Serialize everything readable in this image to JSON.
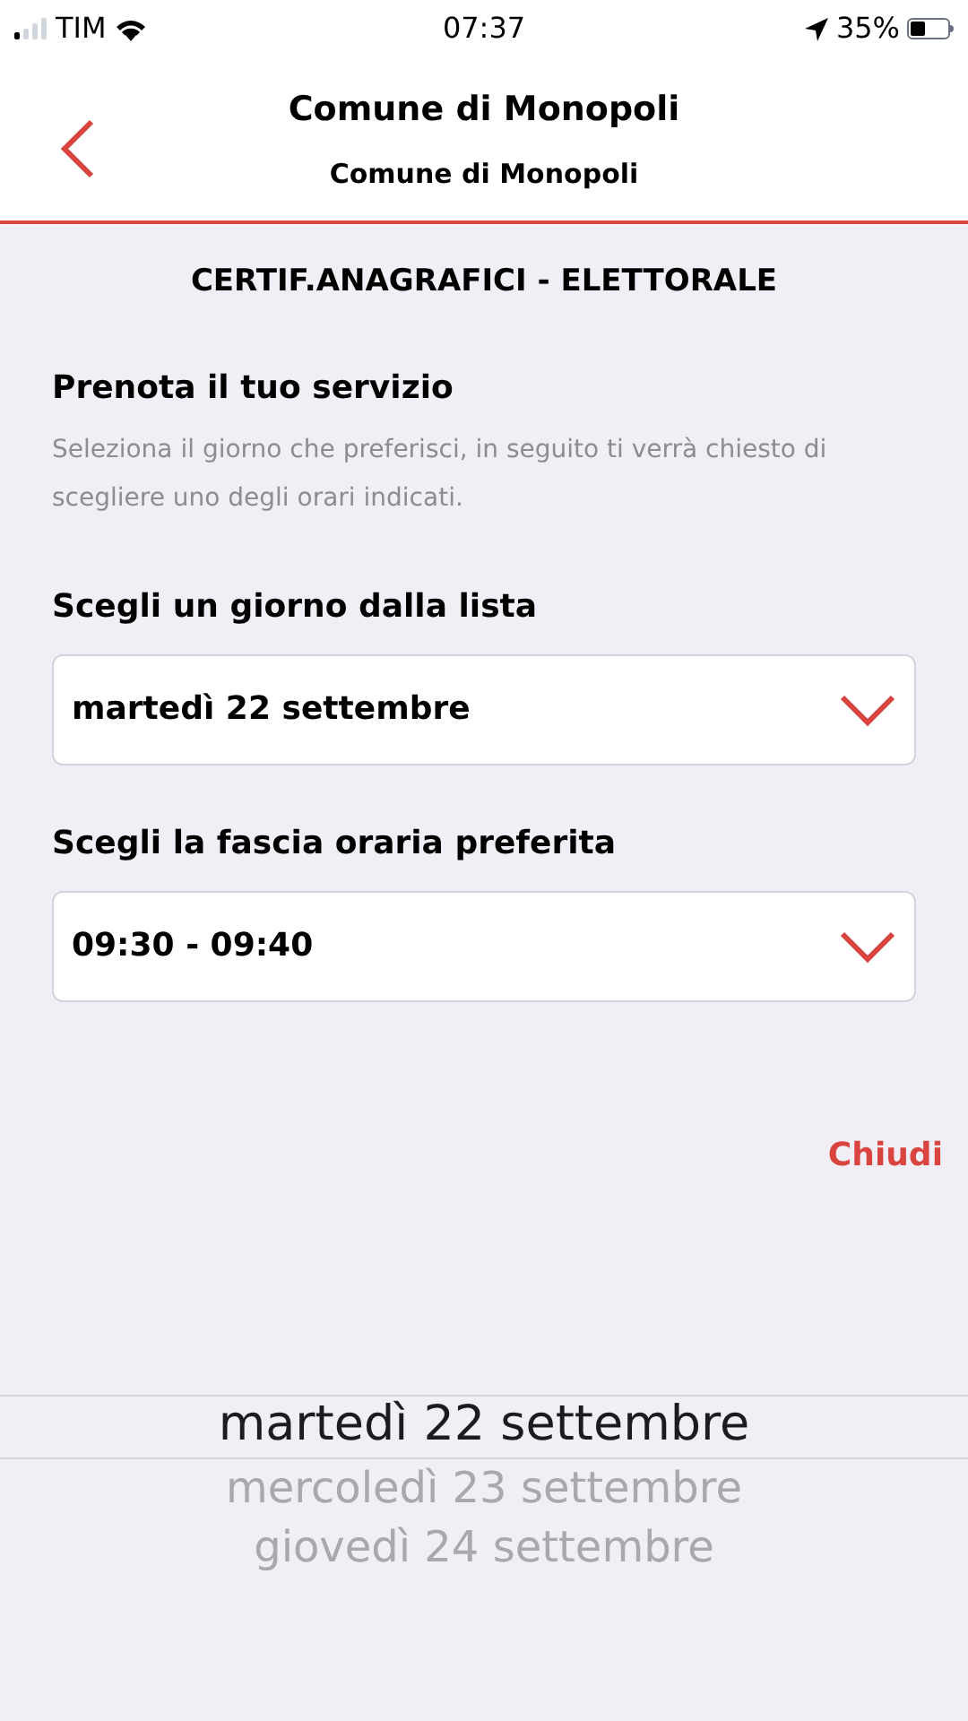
{
  "status_bar": {
    "carrier": "TIM",
    "time": "07:37",
    "battery": "35%"
  },
  "header": {
    "title": "Comune di Monopoli",
    "subtitle": "Comune di Monopoli"
  },
  "service_title": "CERTIF.ANAGRAFICI - ELETTORALE",
  "section": {
    "title": "Prenota il tuo servizio",
    "description": "Seleziona il giorno che preferisci, in seguito ti verrà chiesto di scegliere uno degli orari indicati."
  },
  "fields": [
    {
      "label": "Scegli un giorno dalla lista",
      "value": "martedì 22 settembre"
    },
    {
      "label": "Scegli la fascia oraria preferita",
      "value": "09:30 - 09:40"
    }
  ],
  "close_button": "Chiudi",
  "picker": [
    {
      "label": "martedì 22 settembre",
      "selected": true
    },
    {
      "label": "mercoledì 23 settembre",
      "selected": false
    },
    {
      "label": "giovedì 24 settembre",
      "selected": false
    }
  ]
}
